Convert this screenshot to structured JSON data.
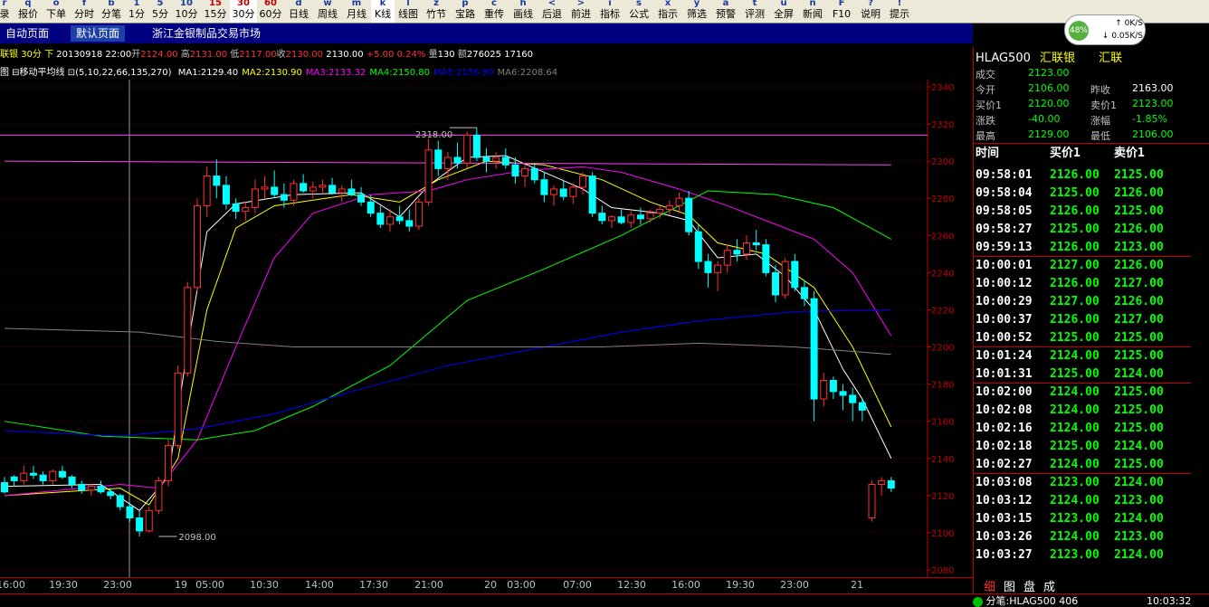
{
  "toolbar": {
    "items": [
      {
        "label": "录",
        "icon": "r"
      },
      {
        "label": "报价",
        "icon": "q"
      },
      {
        "label": "下单",
        "icon": "o"
      },
      {
        "label": "分时",
        "icon": "f"
      },
      {
        "label": "分笔",
        "icon": "b"
      },
      {
        "label": "1分",
        "icon": "1"
      },
      {
        "label": "5分",
        "icon": "5"
      },
      {
        "label": "10分",
        "icon": "10"
      },
      {
        "label": "15分",
        "icon": "15"
      },
      {
        "label": "30分",
        "icon": "30",
        "selected": true
      },
      {
        "label": "60分",
        "icon": "60"
      },
      {
        "label": "日线",
        "icon": "d"
      },
      {
        "label": "周线",
        "icon": "w"
      },
      {
        "label": "月线",
        "icon": "m"
      },
      {
        "label": "K线",
        "icon": "k",
        "selected": true
      },
      {
        "label": "线图",
        "icon": "l"
      },
      {
        "label": "竹节",
        "icon": "z"
      },
      {
        "label": "宝路",
        "icon": "p"
      },
      {
        "label": "重传",
        "icon": "c"
      },
      {
        "label": "画线",
        "icon": "h"
      },
      {
        "label": "后退",
        "icon": "<"
      },
      {
        "label": "前进",
        "icon": ">"
      },
      {
        "label": "指标",
        "icon": "i"
      },
      {
        "label": "公式",
        "icon": "s"
      },
      {
        "label": "指示",
        "icon": "x"
      },
      {
        "label": "筛选",
        "icon": "y"
      },
      {
        "label": "预警",
        "icon": "a"
      },
      {
        "label": "评测",
        "icon": "t"
      },
      {
        "label": "全屏",
        "icon": "u"
      },
      {
        "label": "新闻",
        "icon": "n"
      },
      {
        "label": "F10",
        "icon": "F"
      },
      {
        "label": "说明",
        "icon": "?"
      },
      {
        "label": "提示",
        "icon": "!"
      }
    ]
  },
  "tabs": [
    {
      "label": "自动页面",
      "active": false
    },
    {
      "label": "默认页面",
      "active": true
    },
    {
      "label": "浙江金银制品交易市场",
      "active": false
    }
  ],
  "speed": {
    "percent": "48%",
    "up": "0K/S",
    "down": "0.05K/S"
  },
  "info": {
    "name": "联银",
    "period": "30分",
    "dir": "下",
    "date": "20130918 22:00",
    "open_l": "开",
    "open": "2124.00",
    "high_l": "高",
    "high": "2131.00",
    "low_l": "低",
    "low": "2117.00",
    "close_l": "收",
    "close": "2130.00",
    "last": "2130.00",
    "change": "+5.00",
    "pct": "0.24%",
    "vol_l": "量",
    "vol": "130",
    "amt_l": "额",
    "amt": "276025",
    "oi": "17160"
  },
  "ma": {
    "title": "图 ⊟移动平均线 ⊡(5,10,22,66,135,270)",
    "items": [
      {
        "label": "MA1:2129.40",
        "color": "#ffffff"
      },
      {
        "label": "MA2:2130.90",
        "color": "#ffff00"
      },
      {
        "label": "MA3:2133.32",
        "color": "#ff00ff"
      },
      {
        "label": "MA4:2150.80",
        "color": "#00ff00"
      },
      {
        "label": "MA5:2156.90",
        "color": "#0000ff"
      },
      {
        "label": "MA6:2208.64",
        "color": "#808080"
      }
    ]
  },
  "chart_data": {
    "type": "candlestick",
    "y_range": [
      2080,
      2340
    ],
    "y_ticks": [
      2080,
      2100,
      2120,
      2140,
      2160,
      2180,
      2200,
      2220,
      2240,
      2260,
      2280,
      2300,
      2320,
      2340
    ],
    "x_labels": [
      "16:00",
      "19:30",
      "23:00",
      "19",
      "05:00",
      "10:30",
      "14:00",
      "17:30",
      "21:00",
      "20",
      "03:00",
      "07:00",
      "12:30",
      "16:00",
      "19:30",
      "23:00",
      "21"
    ],
    "hline_levels": [
      2314,
      2298
    ],
    "annotations": [
      {
        "text": "2318.00",
        "value": 2318
      },
      {
        "text": "2098.00",
        "value": 2098
      }
    ],
    "candles": [
      [
        2127,
        2130,
        2121,
        2122
      ],
      [
        2130,
        2131,
        2125,
        2128
      ],
      [
        2128,
        2136,
        2126,
        2132
      ],
      [
        2132,
        2136,
        2129,
        2131
      ],
      [
        2131,
        2133,
        2126,
        2128
      ],
      [
        2128,
        2134,
        2126,
        2133
      ],
      [
        2133,
        2136,
        2129,
        2130
      ],
      [
        2130,
        2131,
        2124,
        2126
      ],
      [
        2126,
        2128,
        2121,
        2123
      ],
      [
        2123,
        2126,
        2120,
        2125
      ],
      [
        2125,
        2128,
        2121,
        2122
      ],
      [
        2122,
        2124,
        2118,
        2120
      ],
      [
        2120,
        2121,
        2112,
        2114
      ],
      [
        2114,
        2116,
        2106,
        2108
      ],
      [
        2108,
        2112,
        2098,
        2101
      ],
      [
        2101,
        2114,
        2100,
        2112
      ],
      [
        2112,
        2130,
        2110,
        2128
      ],
      [
        2128,
        2150,
        2125,
        2147
      ],
      [
        2147,
        2190,
        2145,
        2186
      ],
      [
        2186,
        2235,
        2184,
        2232
      ],
      [
        2232,
        2280,
        2230,
        2276
      ],
      [
        2276,
        2297,
        2270,
        2292
      ],
      [
        2292,
        2301,
        2280,
        2287
      ],
      [
        2287,
        2292,
        2274,
        2277
      ],
      [
        2277,
        2280,
        2269,
        2273
      ],
      [
        2273,
        2278,
        2268,
        2275
      ],
      [
        2275,
        2290,
        2272,
        2285
      ],
      [
        2285,
        2292,
        2280,
        2286
      ],
      [
        2286,
        2295,
        2280,
        2282
      ],
      [
        2282,
        2288,
        2275,
        2279
      ],
      [
        2279,
        2290,
        2276,
        2288
      ],
      [
        2288,
        2293,
        2283,
        2284
      ],
      [
        2284,
        2289,
        2280,
        2286
      ],
      [
        2286,
        2290,
        2283,
        2287
      ],
      [
        2287,
        2291,
        2282,
        2283
      ],
      [
        2283,
        2287,
        2278,
        2285
      ],
      [
        2285,
        2290,
        2281,
        2282
      ],
      [
        2282,
        2286,
        2276,
        2278
      ],
      [
        2278,
        2282,
        2270,
        2272
      ],
      [
        2272,
        2276,
        2264,
        2266
      ],
      [
        2266,
        2274,
        2262,
        2270
      ],
      [
        2270,
        2276,
        2266,
        2268
      ],
      [
        2268,
        2274,
        2262,
        2265
      ],
      [
        2265,
        2280,
        2263,
        2278
      ],
      [
        2278,
        2312,
        2276,
        2306
      ],
      [
        2306,
        2311,
        2292,
        2296
      ],
      [
        2296,
        2305,
        2290,
        2302
      ],
      [
        2302,
        2310,
        2296,
        2299
      ],
      [
        2299,
        2316,
        2296,
        2314
      ],
      [
        2314,
        2318,
        2300,
        2302
      ],
      [
        2302,
        2307,
        2294,
        2300
      ],
      [
        2300,
        2305,
        2296,
        2302
      ],
      [
        2302,
        2307,
        2296,
        2298
      ],
      [
        2298,
        2302,
        2288,
        2292
      ],
      [
        2292,
        2298,
        2286,
        2296
      ],
      [
        2296,
        2299,
        2288,
        2290
      ],
      [
        2290,
        2294,
        2278,
        2282
      ],
      [
        2282,
        2287,
        2276,
        2285
      ],
      [
        2285,
        2290,
        2279,
        2281
      ],
      [
        2281,
        2288,
        2277,
        2286
      ],
      [
        2286,
        2294,
        2282,
        2292
      ],
      [
        2292,
        2294,
        2270,
        2272
      ],
      [
        2272,
        2276,
        2266,
        2268
      ],
      [
        2268,
        2271,
        2264,
        2270
      ],
      [
        2270,
        2274,
        2266,
        2267
      ],
      [
        2267,
        2273,
        2264,
        2271
      ],
      [
        2271,
        2275,
        2266,
        2269
      ],
      [
        2269,
        2274,
        2267,
        2272
      ],
      [
        2272,
        2276,
        2269,
        2274
      ],
      [
        2274,
        2279,
        2271,
        2276
      ],
      [
        2276,
        2283,
        2272,
        2280
      ],
      [
        2280,
        2284,
        2260,
        2262
      ],
      [
        2262,
        2266,
        2242,
        2246
      ],
      [
        2246,
        2250,
        2232,
        2240
      ],
      [
        2240,
        2246,
        2230,
        2244
      ],
      [
        2244,
        2255,
        2240,
        2252
      ],
      [
        2252,
        2258,
        2246,
        2250
      ],
      [
        2250,
        2260,
        2247,
        2256
      ],
      [
        2256,
        2263,
        2252,
        2255
      ],
      [
        2255,
        2258,
        2238,
        2240
      ],
      [
        2240,
        2244,
        2224,
        2228
      ],
      [
        2228,
        2248,
        2226,
        2246
      ],
      [
        2246,
        2250,
        2230,
        2232
      ],
      [
        2232,
        2236,
        2222,
        2226
      ],
      [
        2226,
        2230,
        2160,
        2172
      ],
      [
        2172,
        2186,
        2168,
        2182
      ],
      [
        2182,
        2184,
        2172,
        2176
      ],
      [
        2176,
        2180,
        2166,
        2174
      ],
      [
        2174,
        2178,
        2160,
        2170
      ],
      [
        2170,
        2172,
        2160,
        2166
      ],
      [
        2108,
        2128,
        2106,
        2126
      ],
      [
        2126,
        2130,
        2120,
        2128
      ],
      [
        2128,
        2130,
        2122,
        2124
      ]
    ],
    "ma": [
      {
        "name": "MA1",
        "color": "#ffffff",
        "v": [
          [
            0,
            2125
          ],
          [
            10,
            2126
          ],
          [
            14,
            2112
          ],
          [
            17,
            2130
          ],
          [
            19,
            2200
          ],
          [
            21,
            2262
          ],
          [
            24,
            2277
          ],
          [
            30,
            2282
          ],
          [
            37,
            2283
          ],
          [
            41,
            2270
          ],
          [
            44,
            2287
          ],
          [
            48,
            2302
          ],
          [
            52,
            2303
          ],
          [
            56,
            2294
          ],
          [
            60,
            2285
          ],
          [
            63,
            2275
          ],
          [
            68,
            2272
          ],
          [
            71,
            2268
          ],
          [
            74,
            2248
          ],
          [
            78,
            2250
          ],
          [
            81,
            2238
          ],
          [
            84,
            2220
          ],
          [
            87,
            2188
          ],
          [
            89,
            2172
          ],
          [
            92,
            2140
          ]
        ]
      },
      {
        "name": "MA2",
        "color": "#ffff00",
        "v": [
          [
            0,
            2120
          ],
          [
            12,
            2124
          ],
          [
            15,
            2115
          ],
          [
            18,
            2140
          ],
          [
            21,
            2220
          ],
          [
            24,
            2264
          ],
          [
            28,
            2276
          ],
          [
            36,
            2282
          ],
          [
            41,
            2278
          ],
          [
            45,
            2290
          ],
          [
            50,
            2300
          ],
          [
            56,
            2298
          ],
          [
            62,
            2290
          ],
          [
            67,
            2278
          ],
          [
            71,
            2271
          ],
          [
            74,
            2256
          ],
          [
            79,
            2250
          ],
          [
            84,
            2232
          ],
          [
            88,
            2200
          ],
          [
            92,
            2157
          ]
        ]
      },
      {
        "name": "MA3",
        "color": "#ff00ff",
        "v": [
          [
            0,
            2120
          ],
          [
            12,
            2126
          ],
          [
            16,
            2124
          ],
          [
            20,
            2150
          ],
          [
            24,
            2200
          ],
          [
            28,
            2248
          ],
          [
            32,
            2272
          ],
          [
            38,
            2282
          ],
          [
            44,
            2284
          ],
          [
            48,
            2290
          ],
          [
            54,
            2295
          ],
          [
            60,
            2297
          ],
          [
            64,
            2294
          ],
          [
            70,
            2285
          ],
          [
            75,
            2276
          ],
          [
            80,
            2266
          ],
          [
            84,
            2258
          ],
          [
            88,
            2240
          ],
          [
            92,
            2206
          ]
        ]
      },
      {
        "name": "MA4",
        "color": "#00ff00",
        "v": [
          [
            0,
            2160
          ],
          [
            10,
            2152
          ],
          [
            20,
            2150
          ],
          [
            26,
            2155
          ],
          [
            32,
            2168
          ],
          [
            40,
            2190
          ],
          [
            48,
            2225
          ],
          [
            56,
            2242
          ],
          [
            64,
            2260
          ],
          [
            70,
            2276
          ],
          [
            73,
            2284
          ],
          [
            80,
            2282
          ],
          [
            86,
            2275
          ],
          [
            92,
            2258
          ]
        ]
      },
      {
        "name": "MA5",
        "color": "#0000ff",
        "v": [
          [
            0,
            2155
          ],
          [
            12,
            2152
          ],
          [
            20,
            2156
          ],
          [
            28,
            2164
          ],
          [
            36,
            2176
          ],
          [
            46,
            2190
          ],
          [
            56,
            2200
          ],
          [
            64,
            2208
          ],
          [
            72,
            2214
          ],
          [
            82,
            2219
          ],
          [
            92,
            2220
          ]
        ]
      },
      {
        "name": "MA6",
        "color": "#808080",
        "v": [
          [
            0,
            2210
          ],
          [
            14,
            2208
          ],
          [
            22,
            2203
          ],
          [
            30,
            2200
          ],
          [
            40,
            2200
          ],
          [
            52,
            2200
          ],
          [
            62,
            2200
          ],
          [
            72,
            2202
          ],
          [
            82,
            2200
          ],
          [
            92,
            2196
          ]
        ]
      },
      {
        "name": "HLINE1",
        "color": "#ff40ff",
        "v": [
          [
            0,
            2300
          ],
          [
            92,
            2298
          ]
        ]
      }
    ]
  },
  "right_panel": {
    "code": "HLAG500",
    "name": "汇联银",
    "exch": "汇联",
    "deal_l": "成交",
    "deal": "2123.00",
    "open_l": "今开",
    "open": "2106.00",
    "prev_l": "昨收",
    "prev": "2163.00",
    "bid_l": "买价1",
    "bid": "2120.00",
    "ask_l": "卖价1",
    "ask": "2123.00",
    "chg_l": "涨跌",
    "chg": "-40.00",
    "chgp_l": "涨幅",
    "chgp": "-1.85%",
    "hi_l": "最高",
    "hi": "2129.00",
    "lo_l": "最低",
    "lo": "2106.00",
    "col_time": "时间",
    "col_bid": "买价1",
    "col_ask": "卖价1",
    "ticks": [
      [
        "09:58:01",
        "2126.00",
        "2125.00"
      ],
      [
        "09:58:04",
        "2125.00",
        "2126.00"
      ],
      [
        "09:58:05",
        "2126.00",
        "2125.00"
      ],
      [
        "09:58:27",
        "2125.00",
        "2126.00"
      ],
      [
        "09:59:13",
        "2126.00",
        "2123.00"
      ],
      [
        "10:00:01",
        "2127.00",
        "2126.00"
      ],
      [
        "10:00:12",
        "2126.00",
        "2127.00"
      ],
      [
        "10:00:29",
        "2127.00",
        "2126.00"
      ],
      [
        "10:00:37",
        "2126.00",
        "2127.00"
      ],
      [
        "10:00:52",
        "2125.00",
        "2125.00"
      ],
      [
        "10:01:24",
        "2124.00",
        "2125.00"
      ],
      [
        "10:01:31",
        "2125.00",
        "2124.00"
      ],
      [
        "10:02:00",
        "2124.00",
        "2125.00"
      ],
      [
        "10:02:08",
        "2124.00",
        "2125.00"
      ],
      [
        "10:02:16",
        "2124.00",
        "2125.00"
      ],
      [
        "10:02:18",
        "2125.00",
        "2124.00"
      ],
      [
        "10:02:27",
        "2124.00",
        "2125.00"
      ],
      [
        "10:03:08",
        "2123.00",
        "2124.00"
      ],
      [
        "10:03:12",
        "2124.00",
        "2123.00"
      ],
      [
        "10:03:15",
        "2123.00",
        "2124.00"
      ],
      [
        "10:03:26",
        "2124.00",
        "2123.00"
      ],
      [
        "10:03:27",
        "2123.00",
        "2124.00"
      ]
    ],
    "tabs": [
      "细",
      "图",
      "盘",
      "成"
    ],
    "status": "分笔:HLAG500 406",
    "clock": "10:03:32"
  },
  "colors": {
    "up": "#ff3030",
    "down": "#00ffff",
    "axis": "#c00000",
    "text": "#c0c0c0"
  }
}
